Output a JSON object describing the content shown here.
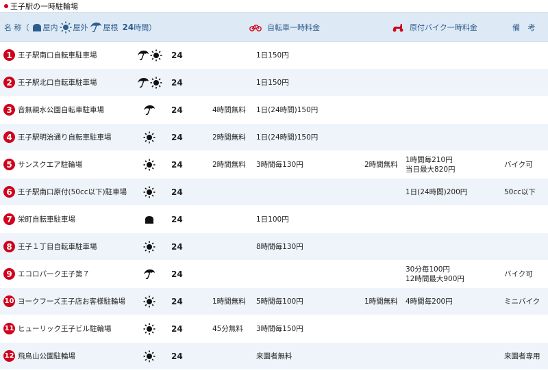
{
  "title": "王子駅の一時駐輪場",
  "header": {
    "name_label": "名 称（",
    "indoor_label": "屋内",
    "outdoor_label": "屋外",
    "roof_label": "屋根",
    "hours_label": "24",
    "hours_suffix": "時間）",
    "bike_label": "自転車一時料金",
    "moto_label": "原付バイク一時料金",
    "note_label": "備 考"
  },
  "colors": {
    "header_bg": "#dde9f4",
    "alt_row_bg": "#eef4fa",
    "number_badge": "#d0021b",
    "header_text": "#2d5d8f"
  },
  "rows": [
    {
      "num": "1",
      "name": "王子駅南口自転車駐車場",
      "icons": [
        "umbrella-icon",
        "sun-icon"
      ],
      "hours": "24",
      "bike_free": "",
      "bike_fee": "1日150円",
      "moto_free": "",
      "moto_fee": "",
      "note": ""
    },
    {
      "num": "2",
      "name": "王子駅北口自転車駐車場",
      "icons": [
        "umbrella-icon",
        "sun-icon"
      ],
      "hours": "24",
      "bike_free": "",
      "bike_fee": "1日150円",
      "moto_free": "",
      "moto_fee": "",
      "note": ""
    },
    {
      "num": "3",
      "name": "音無親水公園自転車駐車場",
      "icons": [
        "umbrella-icon"
      ],
      "hours": "24",
      "bike_free": "4時間無料",
      "bike_fee": "1日(24時間)150円",
      "moto_free": "",
      "moto_fee": "",
      "note": ""
    },
    {
      "num": "4",
      "name": "王子駅明治通り自転車駐車場",
      "icons": [
        "sun-icon"
      ],
      "hours": "24",
      "bike_free": "2時間無料",
      "bike_fee": "1日(24時間)150円",
      "moto_free": "",
      "moto_fee": "",
      "note": ""
    },
    {
      "num": "5",
      "name": "サンスクエア駐輪場",
      "icons": [
        "sun-icon"
      ],
      "hours": "24",
      "bike_free": "2時間無料",
      "bike_fee": "3時間毎130円",
      "moto_free": "2時間無料",
      "moto_fee": "1時間毎210円\n当日最大820円",
      "note": "バイク可"
    },
    {
      "num": "6",
      "name": "王子駅南口原付(50cc以下)駐車場",
      "icons": [
        "sun-icon"
      ],
      "hours": "24",
      "bike_free": "",
      "bike_fee": "",
      "moto_free": "",
      "moto_fee": "1日(24時間)200円",
      "note": "50cc以下"
    },
    {
      "num": "7",
      "name": "栄町自転車駐車場",
      "icons": [
        "indoor-icon"
      ],
      "hours": "24",
      "bike_free": "",
      "bike_fee": "1日100円",
      "moto_free": "",
      "moto_fee": "",
      "note": ""
    },
    {
      "num": "8",
      "name": "王子１丁目自転車駐車場",
      "icons": [
        "sun-icon"
      ],
      "hours": "24",
      "bike_free": "",
      "bike_fee": "8時間毎130円",
      "moto_free": "",
      "moto_fee": "",
      "note": ""
    },
    {
      "num": "9",
      "name": "エコロパーク王子第７",
      "icons": [
        "umbrella-icon"
      ],
      "hours": "24",
      "bike_free": "",
      "bike_fee": "",
      "moto_free": "",
      "moto_fee": "30分毎100円\n12時間最大900円",
      "note": "バイク可"
    },
    {
      "num": "10",
      "name": "ヨークフーズ王子店お客様駐輪場",
      "icons": [
        "sun-icon"
      ],
      "hours": "24",
      "bike_free": "1時間無料",
      "bike_fee": "5時間毎100円",
      "moto_free": "1時間無料",
      "moto_fee": "4時間毎200円",
      "note": "ミニバイク"
    },
    {
      "num": "11",
      "name": "ヒューリック王子ビル駐輪場",
      "icons": [
        "sun-icon"
      ],
      "hours": "24",
      "bike_free": "45分無料",
      "bike_fee": "3時間毎150円",
      "moto_free": "",
      "moto_fee": "",
      "note": ""
    },
    {
      "num": "12",
      "name": "飛鳥山公園駐輪場",
      "icons": [
        "sun-icon"
      ],
      "hours": "24",
      "bike_free": "",
      "bike_fee": "来園者無料",
      "moto_free": "",
      "moto_fee": "",
      "note": "来園者専用"
    }
  ]
}
